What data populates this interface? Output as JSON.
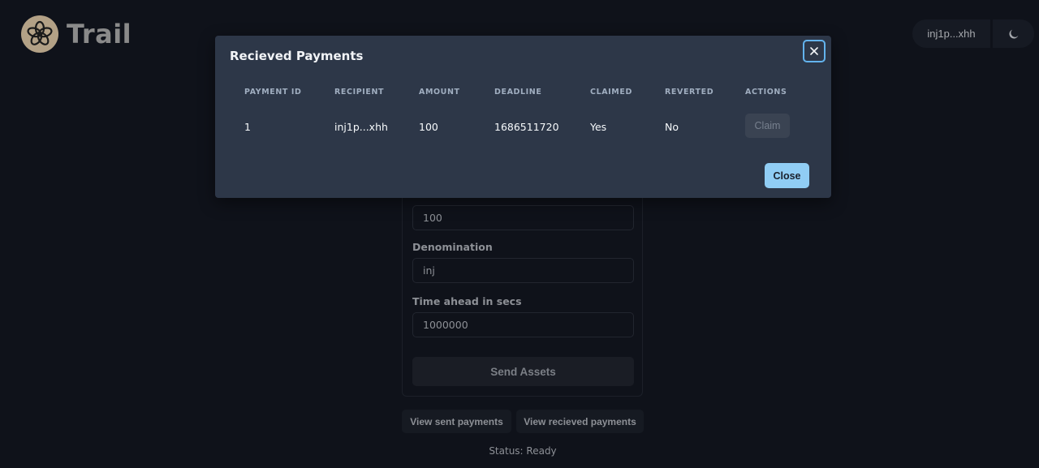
{
  "app": {
    "title": "Trail"
  },
  "header": {
    "wallet_address": "inj1p...xhh",
    "theme_icon": "moon-icon"
  },
  "form": {
    "amount_value": "100",
    "denomination_label": "Denomination",
    "denomination_value": "inj",
    "time_label": "Time ahead in secs",
    "time_value": "1000000",
    "send_label": "Send Assets"
  },
  "links": {
    "sent_label": "View sent payments",
    "received_label": "View recieved payments"
  },
  "status": {
    "text": "Status: Ready"
  },
  "modal": {
    "title": "Recieved Payments",
    "columns": [
      "PAYMENT ID",
      "RECIPIENT",
      "AMOUNT",
      "DEADLINE",
      "CLAIMED",
      "REVERTED",
      "ACTIONS"
    ],
    "rows": [
      {
        "payment_id": "1",
        "recipient": "inj1p...xhh",
        "amount": "100",
        "deadline": "1686511720",
        "claimed": "Yes",
        "reverted": "No",
        "action": "Claim"
      }
    ],
    "close_label": "Close"
  },
  "colors": {
    "accent": "#90cdf4",
    "modal_bg": "#2d3748",
    "page_bg": "#0f121a"
  }
}
